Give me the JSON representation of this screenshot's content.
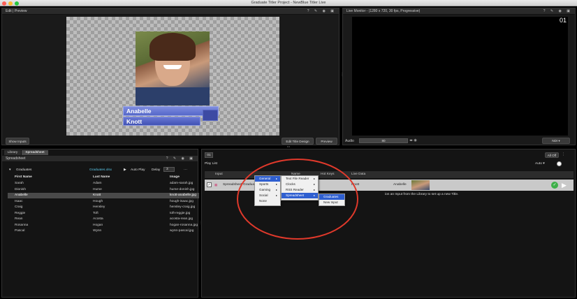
{
  "window": {
    "title": "Graduate Titler Project - NewBlue Titler Live"
  },
  "edit_panel": {
    "title": "Edit | Preview",
    "name_first": "Anabelle",
    "name_last": "Knott",
    "show_inputs": "Show Inputs",
    "edit_title_design": "Edit Title Design",
    "preview": "Preview"
  },
  "live_panel": {
    "title": "Live Monitor - (1280 x 720, 30 fps, Progressive)",
    "channel": "01",
    "audio_label": "Audio",
    "audio_value": "80",
    "ndi": "NDI"
  },
  "library": {
    "tabs": [
      "Library",
      "Spreadsheet"
    ],
    "header": "Spreadsheet",
    "sheet_name": "Graduates",
    "file": "Graduates.xlsx",
    "auto_play": "Auto Play",
    "delay_label": "Delay",
    "delay_value": "3",
    "columns": [
      "First Name",
      "Last Name",
      "Image"
    ],
    "rows": [
      [
        "Sarah",
        "Adam",
        "adam-sarah.jpg"
      ],
      [
        "Dionish",
        "Hume",
        "hume-donish.jpg"
      ],
      [
        "Anabelle",
        "Knott",
        "knott-anabelle.jpg"
      ],
      [
        "Isaac",
        "Hough",
        "hough-isaac.jpg"
      ],
      [
        "Craig",
        "Hensley",
        "hensley-craig.jpg"
      ],
      [
        "Reggie",
        "Toft",
        "toft-reggie.jpg"
      ],
      [
        "Rean",
        "Acosta",
        "acosta-rean.jpg"
      ],
      [
        "Rosanna",
        "Hogan",
        "hogan-rosanna.jpg"
      ],
      [
        "Pascal",
        "Wynn",
        "wynn-pascal.jpg"
      ]
    ]
  },
  "playlist": {
    "tab": "01",
    "all_off": "All Off",
    "header": "Play List",
    "auto": "Auto",
    "columns": [
      "Input",
      "Name",
      "Hot Keys",
      "Live Data"
    ],
    "row_input": "Spreadsheet",
    "row_input2": "Graduat",
    "row_live1": "Knott",
    "row_live2": "Anabelle",
    "hint": "ion an Input from the Library to set up a new Title."
  },
  "context_menu": {
    "items": [
      "General",
      "Sports",
      "Gaming",
      "Social",
      "None"
    ],
    "submenu": [
      "Text File Reader",
      "Clocks",
      "RSS Reader",
      "Spreadsheet"
    ],
    "submenu2": [
      "Graduates",
      "New Input"
    ]
  }
}
